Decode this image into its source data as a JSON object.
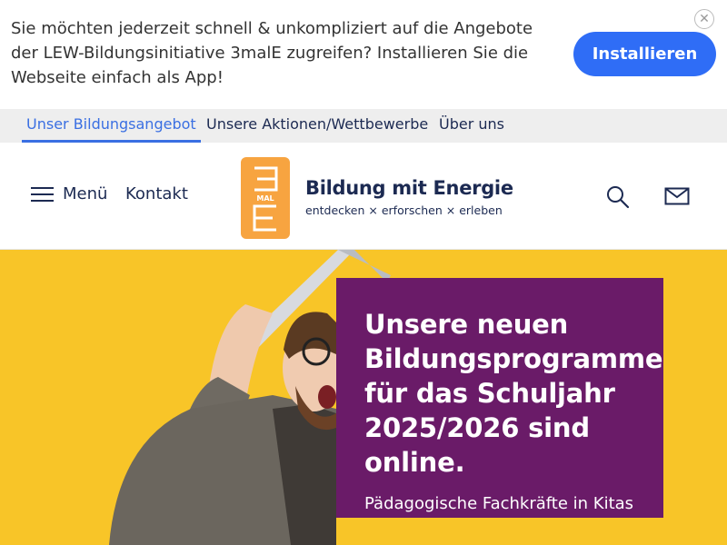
{
  "install_banner": {
    "message": "Sie möchten jederzeit schnell & unkompliziert auf die Angebote der LEW-Bildungsinitiative 3malE zugreifen? Installieren Sie die Webseite einfach als App!",
    "install_label": "Installieren",
    "close_icon": "close-icon",
    "colors": {
      "button": "#2f6df6"
    }
  },
  "top_nav": {
    "items": [
      {
        "label": "Unser Bildungsangebot",
        "active": true
      },
      {
        "label": "Unsere Aktionen/Wettbewerbe",
        "active": false
      },
      {
        "label": "Über uns",
        "active": false
      }
    ],
    "colors": {
      "active": "#3a6fe2",
      "background": "#eeeeee"
    }
  },
  "header": {
    "menu_label": "Menü",
    "contact_label": "Kontakt",
    "logo_text": "MAL",
    "brand_title": "Bildung mit Energie",
    "brand_subtitle": "entdecken × erforschen × erleben",
    "icons": [
      "hamburger-icon",
      "search-icon",
      "mail-icon"
    ],
    "colors": {
      "logo": "#f7a440",
      "text": "#1c2a52"
    }
  },
  "hero": {
    "heading": "Unsere neuen Bildungsprogramme für das Schuljahr 2025/2026 sind online.",
    "subtext": "Pädagogische Fachkräfte in Kitas",
    "colors": {
      "background": "#f8c528",
      "card": "#6a1b68"
    }
  }
}
